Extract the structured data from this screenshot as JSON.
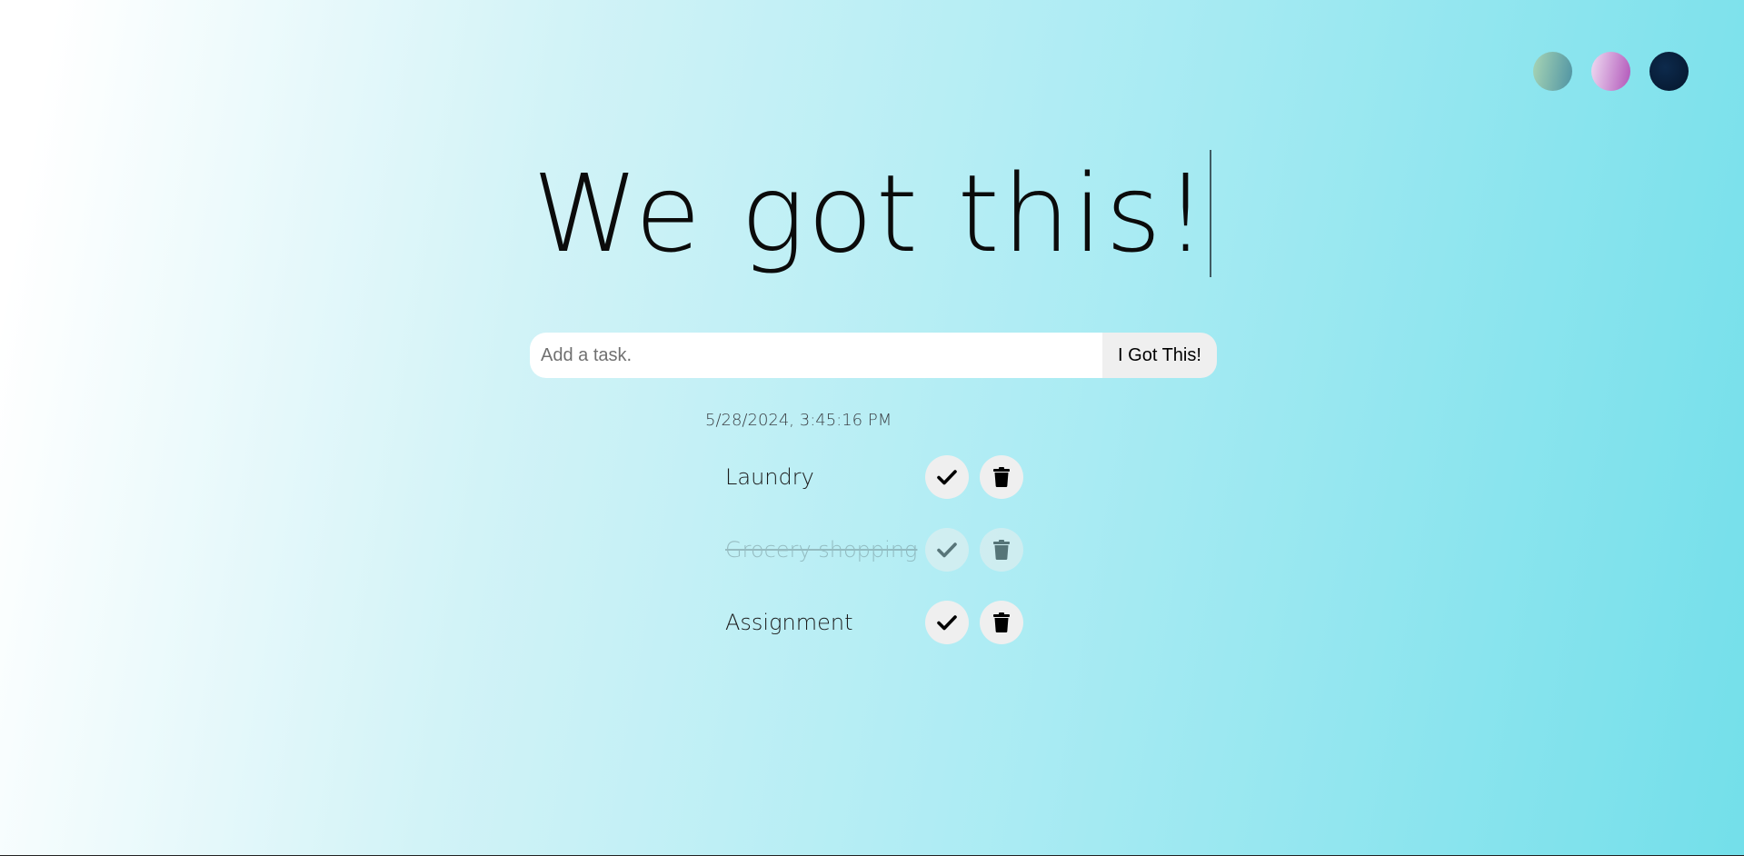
{
  "theme_switcher": {
    "themes": [
      {
        "name": "standard",
        "color": "#5f9fa9"
      },
      {
        "name": "light",
        "color": "#c77ccf"
      },
      {
        "name": "darker",
        "color": "#04152b"
      }
    ]
  },
  "header": {
    "title": "We got this!"
  },
  "form": {
    "placeholder": "Add a task.",
    "value": "",
    "submit_label": "I Got This!"
  },
  "datetime": "5/28/2024, 3:45:16 PM",
  "tasks": [
    {
      "label": "Laundry",
      "completed": false,
      "check_icon": "check-icon",
      "delete_icon": "trash-icon"
    },
    {
      "label": "Grocery shopping",
      "completed": true,
      "check_icon": "check-icon",
      "delete_icon": "trash-icon"
    },
    {
      "label": "Assignment",
      "completed": false,
      "check_icon": "check-icon",
      "delete_icon": "trash-icon"
    }
  ]
}
